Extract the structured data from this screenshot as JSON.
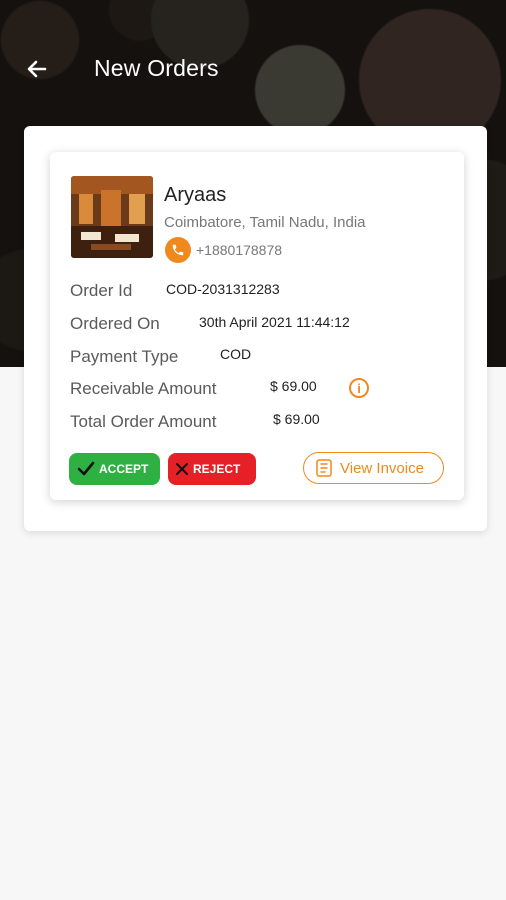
{
  "header": {
    "title": "New Orders",
    "back_icon": "arrow-left-icon"
  },
  "restaurant": {
    "name": "Aryaas",
    "address": "Coimbatore, Tamil Nadu, India",
    "phone": "+1880178878",
    "phone_icon": "phone-icon"
  },
  "order": {
    "order_id_label": "Order Id",
    "order_id": "COD-2031312283",
    "ordered_on_label": "Ordered On",
    "ordered_on": "30th April 2021 11:44:12",
    "payment_type_label": "Payment Type",
    "payment_type": "COD",
    "receivable_label": "Receivable Amount",
    "receivable": "$ 69.00",
    "total_label": "Total Order Amount",
    "total": "$ 69.00",
    "info_icon": "info-icon"
  },
  "actions": {
    "accept_label": "ACCEPT",
    "reject_label": "REJECT",
    "invoice_label": "View Invoice"
  },
  "colors": {
    "accent": "#f0891d",
    "accept": "#2eb043",
    "reject": "#e52027"
  }
}
